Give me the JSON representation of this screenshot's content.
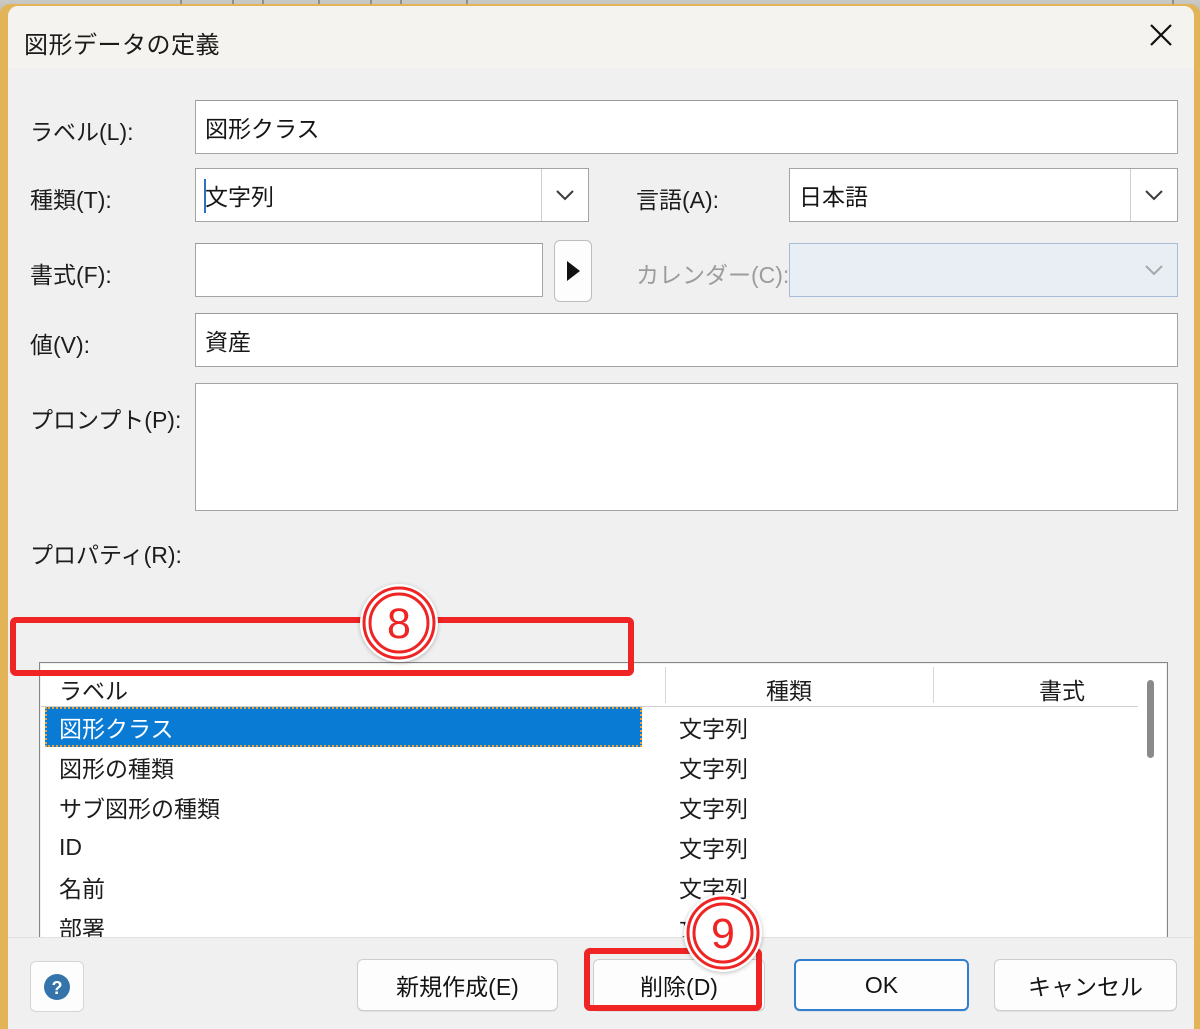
{
  "window": {
    "title": "図形データの定義",
    "close_icon": "close-icon"
  },
  "form": {
    "label_field": {
      "label": "ラベル(L):",
      "value": "図形クラス"
    },
    "type_field": {
      "label": "種類(T):",
      "value": "文字列"
    },
    "language_field": {
      "label": "言語(A):",
      "value": "日本語"
    },
    "format_field": {
      "label": "書式(F):",
      "value": "",
      "expand_icon": "right-triangle-icon"
    },
    "calendar_field": {
      "label": "カレンダー(C):",
      "value": "",
      "disabled": true
    },
    "value_field": {
      "label": "値(V):",
      "value": "資産"
    },
    "prompt_field": {
      "label": "プロンプト(P):",
      "value": ""
    }
  },
  "properties": {
    "caption": "プロパティ(R):",
    "columns": [
      "ラベル",
      "種類",
      "書式"
    ],
    "rows": [
      {
        "label": "図形クラス",
        "type": "文字列",
        "format": "",
        "selected": true
      },
      {
        "label": "図形の種類",
        "type": "文字列",
        "format": "",
        "selected": false
      },
      {
        "label": "サブ図形の種類",
        "type": "文字列",
        "format": "",
        "selected": false
      },
      {
        "label": "ID",
        "type": "文字列",
        "format": "",
        "selected": false
      },
      {
        "label": "名前",
        "type": "文字列",
        "format": "",
        "selected": false
      },
      {
        "label": "部署",
        "type": "文字列",
        "format": "",
        "selected": false
      }
    ]
  },
  "footer": {
    "help_label": "?",
    "new_button": "新規作成(E)",
    "delete_button": "削除(D)",
    "ok_button": "OK",
    "cancel_button": "キャンセル"
  },
  "annotations": [
    {
      "number": "8",
      "target": "selected-property-row"
    },
    {
      "number": "9",
      "target": "delete-button"
    }
  ],
  "colors": {
    "selection_blue": "#0a7bd4",
    "annotation_red": "#ef2424",
    "default_button_blue": "#2f7fd1",
    "dialog_background": "#f0f0f0",
    "titlebar_background": "#f4f3ef",
    "behind_window_edge": "#e3b457"
  }
}
